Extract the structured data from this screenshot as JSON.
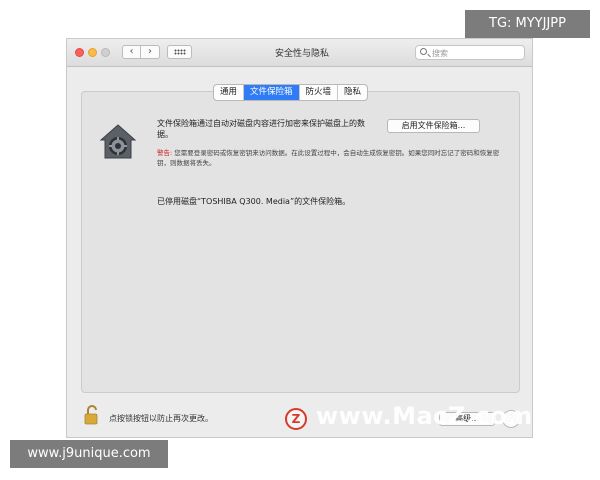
{
  "window": {
    "title": "安全性与隐私",
    "search_placeholder": "搜索",
    "nav_back": "‹",
    "nav_forward": "›"
  },
  "tabs": [
    {
      "label": "通用",
      "active": false
    },
    {
      "label": "文件保险箱",
      "active": true
    },
    {
      "label": "防火墙",
      "active": false
    },
    {
      "label": "隐私",
      "active": false
    }
  ],
  "filevault": {
    "description": "文件保险箱通过自动对磁盘内容进行加密来保护磁盘上的数据。",
    "enable_button": "启用文件保险箱...",
    "warning_label": "警告:",
    "warning_text": "您需要登录密码或恢复密钥来访问数据。在此设置过程中，会自动生成恢复密钥。如果您同时忘记了密码和恢复密钥，则数据将丢失。",
    "status": "已停用磁盘“TOSHIBA Q300. Media”的文件保险箱。"
  },
  "footer": {
    "lock_text": "点按锁按钮以防止再次更改。",
    "advanced_button": "高级...",
    "help_button": "?"
  },
  "watermarks": {
    "top_right": "TG: MYYJJPP",
    "bottom_left": "www.j9unique.com",
    "logo_letter": "Z",
    "site": "www.MacZ.com"
  },
  "colors": {
    "accent": "#2f7cf6",
    "warning": "#d01a1a",
    "close": "#fc605c",
    "minimize": "#fdbc40"
  }
}
